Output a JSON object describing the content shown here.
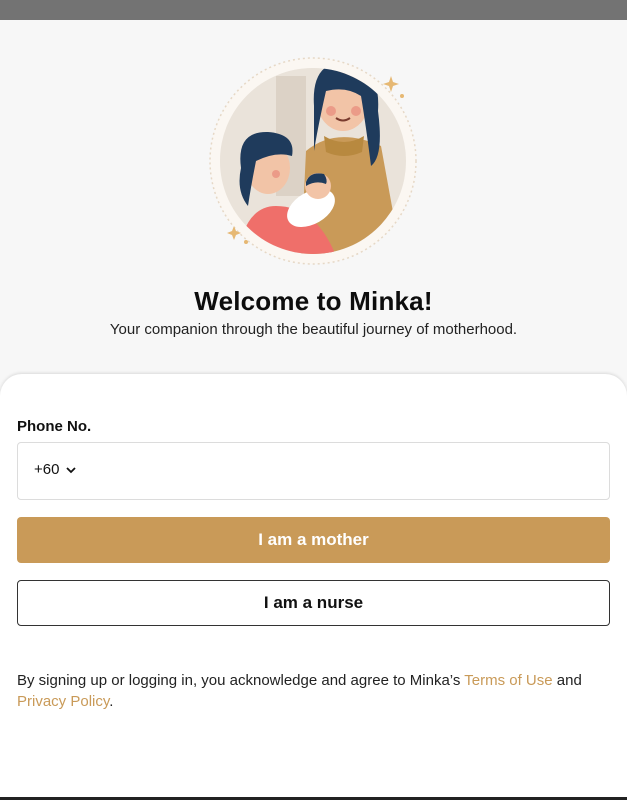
{
  "status_bar": {
    "color": "#737373"
  },
  "hero": {
    "illustration": "mother-and-nurse-with-baby-illustration",
    "title": "Welcome to Minka!",
    "subtitle": "Your companion through the beautiful journey of motherhood."
  },
  "form": {
    "phone_label": "Phone No.",
    "country_code": "+60",
    "phone_value": "",
    "phone_placeholder": ""
  },
  "buttons": {
    "mother_label": "I am a mother",
    "nurse_label": "I am a nurse"
  },
  "legal": {
    "text_before": "By signing up or logging in, you acknowledge and agree to Minka’s ",
    "terms_link": "Terms of Use",
    "text_between": " and ",
    "privacy_link": "Privacy Policy",
    "text_after": "."
  },
  "colors": {
    "accent": "#c99a58",
    "background": "#f7f7f7",
    "card": "#ffffff"
  }
}
